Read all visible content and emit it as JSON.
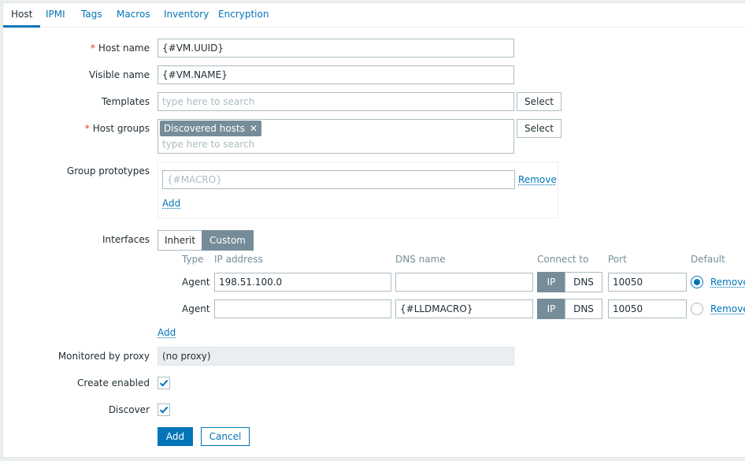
{
  "tabs": [
    {
      "label": "Host"
    },
    {
      "label": "IPMI"
    },
    {
      "label": "Tags"
    },
    {
      "label": "Macros"
    },
    {
      "label": "Inventory"
    },
    {
      "label": "Encryption"
    }
  ],
  "form": {
    "host_name": {
      "label": "Host name",
      "value": "{#VM.UUID}",
      "required": true
    },
    "visible_name": {
      "label": "Visible name",
      "value": "{#VM.NAME}"
    },
    "templates": {
      "label": "Templates",
      "placeholder": "type here to search",
      "select_label": "Select"
    },
    "host_groups": {
      "label": "Host groups",
      "required": true,
      "chip": "Discovered hosts",
      "chip_remove": "✕",
      "placeholder": "type here to search",
      "select_label": "Select"
    },
    "group_prototypes": {
      "label": "Group prototypes",
      "placeholder": "{#MACRO}",
      "remove_label": "Remove",
      "add_label": "Add"
    },
    "interfaces": {
      "label": "Interfaces",
      "mode_options": [
        "Inherit",
        "Custom"
      ],
      "mode_selected": "Custom",
      "columns": [
        "Type",
        "IP address",
        "DNS name",
        "Connect to",
        "Port",
        "Default"
      ],
      "rows": [
        {
          "type": "Agent",
          "ip": "198.51.100.0",
          "dns": "",
          "connect_ip": "IP",
          "connect_dns": "DNS",
          "connect_selected": "IP",
          "port": "10050",
          "default": true,
          "remove": "Remove"
        },
        {
          "type": "Agent",
          "ip": "",
          "dns": "{#LLDMACRO}",
          "connect_ip": "IP",
          "connect_dns": "DNS",
          "connect_selected": "IP",
          "port": "10050",
          "default": false,
          "remove": "Remove"
        }
      ],
      "add_label": "Add"
    },
    "monitored_by_proxy": {
      "label": "Monitored by proxy",
      "value": "(no proxy)"
    },
    "create_enabled": {
      "label": "Create enabled",
      "checked": true
    },
    "discover": {
      "label": "Discover",
      "checked": true
    }
  },
  "actions": {
    "add": "Add",
    "cancel": "Cancel"
  },
  "colors": {
    "accent": "#0275b8",
    "required": "#e33734",
    "chip": "#768d99"
  }
}
